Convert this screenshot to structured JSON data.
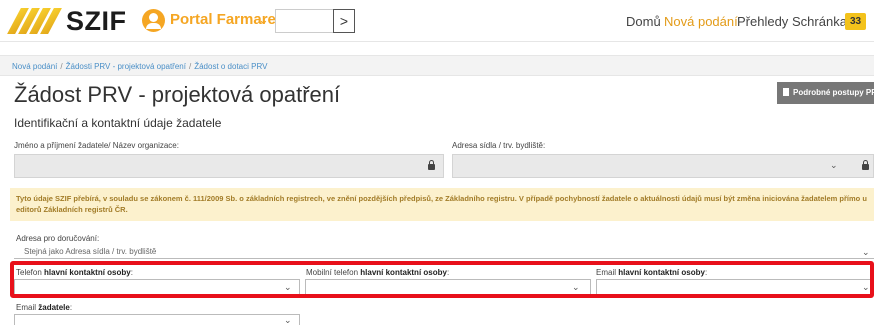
{
  "header": {
    "logo_text": "SZIF",
    "portal_label": "Portal Farmare",
    "nav": [
      {
        "label": "Domů",
        "active": false
      },
      {
        "label": "Nová podání",
        "active": true
      },
      {
        "label": "Přehledy",
        "active": false
      },
      {
        "label": "Schránka",
        "active": false
      }
    ],
    "inbox_count": "33",
    "accent_color": "#f5a623"
  },
  "breadcrumb": [
    "Nová podání",
    "Žádosti PRV - projektová opatření",
    "Žádost o dotaci PRV"
  ],
  "page_title": "Žádost PRV - projektová opatření",
  "procedures_button": "Podrobné postupy PRV",
  "section_title": "Identifikační a kontaktní údaje žadatele",
  "fields": {
    "name_label": "Jméno a příjmení žadatele/ Název organizace:",
    "address_label": "Adresa sídla / trv. bydliště:"
  },
  "notice": "Tyto údaje SZIF přebírá, v souladu se zákonem č. 111/2009 Sb. o základních registrech, ve znění pozdějších předpisů, ze Základního registru. V případě pochybností žadatele o aktuálnosti údajů musí být změna iniciována žadatelem přímo u editorů Základních registrů ČR.",
  "delivery": {
    "label": "Adresa pro doručování:",
    "value": "Stejná jako Adresa sídla / trv. bydliště"
  },
  "contacts": {
    "phone_prefix": "Telefon",
    "phone_bold": "hlavní kontaktní osoby",
    "mobile_prefix": "Mobilní telefon",
    "mobile_bold": "hlavní kontaktní osoby",
    "email_prefix": "Email",
    "email_bold": "hlavní kontaktní osoby",
    "applicant_email_prefix": "Email",
    "applicant_email_bold": "žadatele",
    "suffix": ":"
  }
}
